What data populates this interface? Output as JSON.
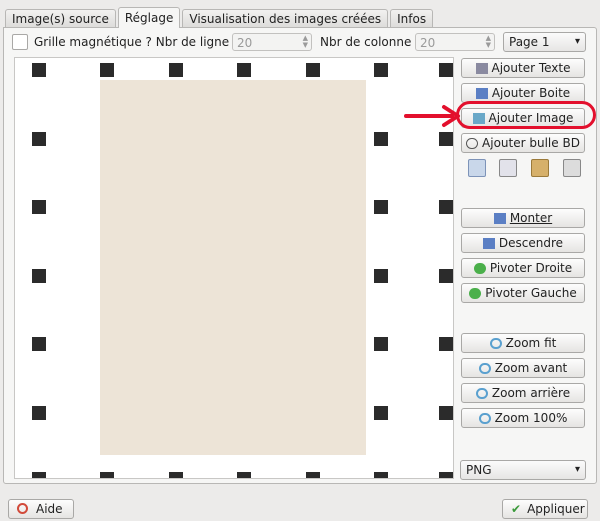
{
  "tabs": [
    {
      "label": "Image(s) source",
      "active": false
    },
    {
      "label": "Réglage",
      "active": true
    },
    {
      "label": "Visualisation des images créées",
      "active": false
    },
    {
      "label": "Infos",
      "active": false
    }
  ],
  "grid": {
    "magnetic_label": "Grille magnétique ? Nbr de ligne :",
    "rows_value": "20",
    "cols_label": "Nbr de colonne :",
    "cols_value": "20",
    "page_select": "Page 1"
  },
  "buttons": {
    "add_text": "Ajouter Texte",
    "add_box": "Ajouter Boite",
    "add_image": "Ajouter Image",
    "add_bubble": "Ajouter bulle BD",
    "move_up": "Monter",
    "move_down": "Descendre",
    "rotate_right": "Pivoter Droite",
    "rotate_left": "Pivoter Gauche",
    "zoom_fit": "Zoom fit",
    "zoom_in": "Zoom avant",
    "zoom_out": "Zoom arrière",
    "zoom_100": "Zoom 100%"
  },
  "format_select": "PNG",
  "footer": {
    "help": "Aide",
    "apply": "Appliquer"
  },
  "colors": {
    "annotation": "#e3102d",
    "page": "#ede4d7",
    "grid_marker": "#2b2b2b"
  }
}
